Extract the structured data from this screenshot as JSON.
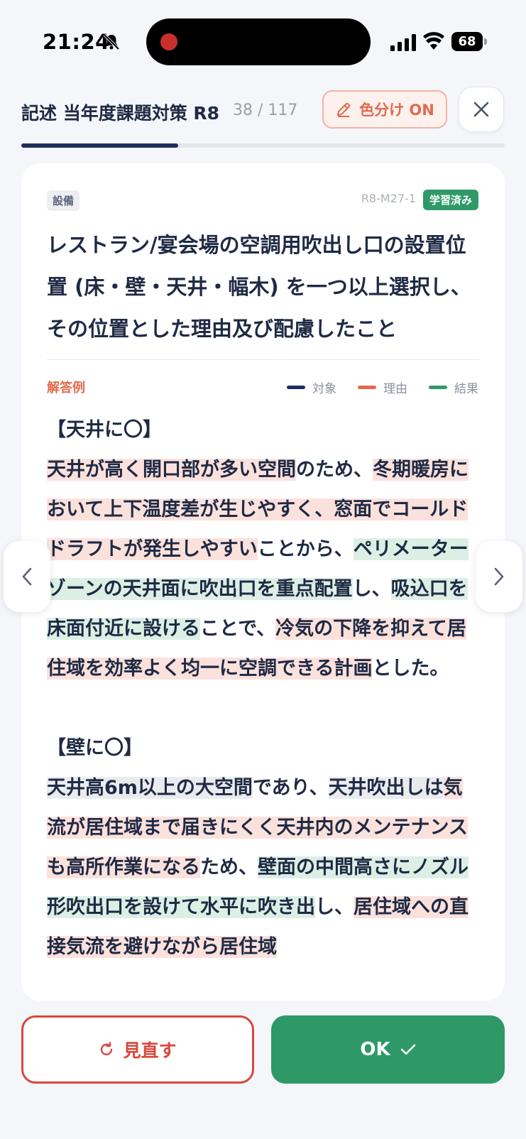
{
  "status_bar": {
    "time": "21:24",
    "battery": "68"
  },
  "header": {
    "title": "記述 当年度課題対策 R8",
    "counter": "38 / 117",
    "color_toggle_label": "色分け ON",
    "progress_fraction": 0.325
  },
  "card": {
    "category": "設備",
    "question_id": "R8-M27-1",
    "status_badge": "学習済み",
    "question": "レストラン/宴会場の空調用吹出し口の設置位置 (床・壁・天井・幅木) を一つ以上選択し、その位置とした理由及び配慮したこと",
    "answer_label": "解答例",
    "legend": [
      {
        "label": "対象",
        "color": "#1d2f5c"
      },
      {
        "label": "理由",
        "color": "#e26a4e"
      },
      {
        "label": "結果",
        "color": "#2f9a68"
      }
    ],
    "sections": [
      {
        "heading": "【天井に〇】",
        "segments": [
          {
            "text": "天井が高く開口部が多い空間",
            "hl": "pink"
          },
          {
            "text": "のため、",
            "hl": "none"
          },
          {
            "text": "冬期暖房において上下温度差が生じやすく、窓面でコールドドラフトが発生しやすい",
            "hl": "pink"
          },
          {
            "text": "ことから、",
            "hl": "none"
          },
          {
            "text": "ペリメーターゾーンの天井面に吹出口を重点配置",
            "hl": "green"
          },
          {
            "text": "し、",
            "hl": "none"
          },
          {
            "text": "吸込口を床面付近に設ける",
            "hl": "green"
          },
          {
            "text": "ことで、",
            "hl": "none"
          },
          {
            "text": "冷気の下降を抑えて居住域を効率よく均一に空調できる計画",
            "hl": "pink"
          },
          {
            "text": "とした。",
            "hl": "none"
          }
        ]
      },
      {
        "heading": "【壁に〇】",
        "segments": [
          {
            "text": "天井高6m以上の大空間",
            "hl": "gray"
          },
          {
            "text": "であり、",
            "hl": "none"
          },
          {
            "text": "天井吹出しは",
            "hl": "gray"
          },
          {
            "text": "気流が居住域まで届きにくく天井内のメンテナンスも高所作業になる",
            "hl": "pink"
          },
          {
            "text": "ため、",
            "hl": "none"
          },
          {
            "text": "壁面の中間高さにノズル形吹出口を設けて水平に吹き出",
            "hl": "green"
          },
          {
            "text": "し、",
            "hl": "none"
          },
          {
            "text": "居住域への直接気流を避けながら居住域",
            "hl": "pink"
          }
        ]
      }
    ]
  },
  "buttons": {
    "review_label": "見直す",
    "ok_label": "OK"
  }
}
